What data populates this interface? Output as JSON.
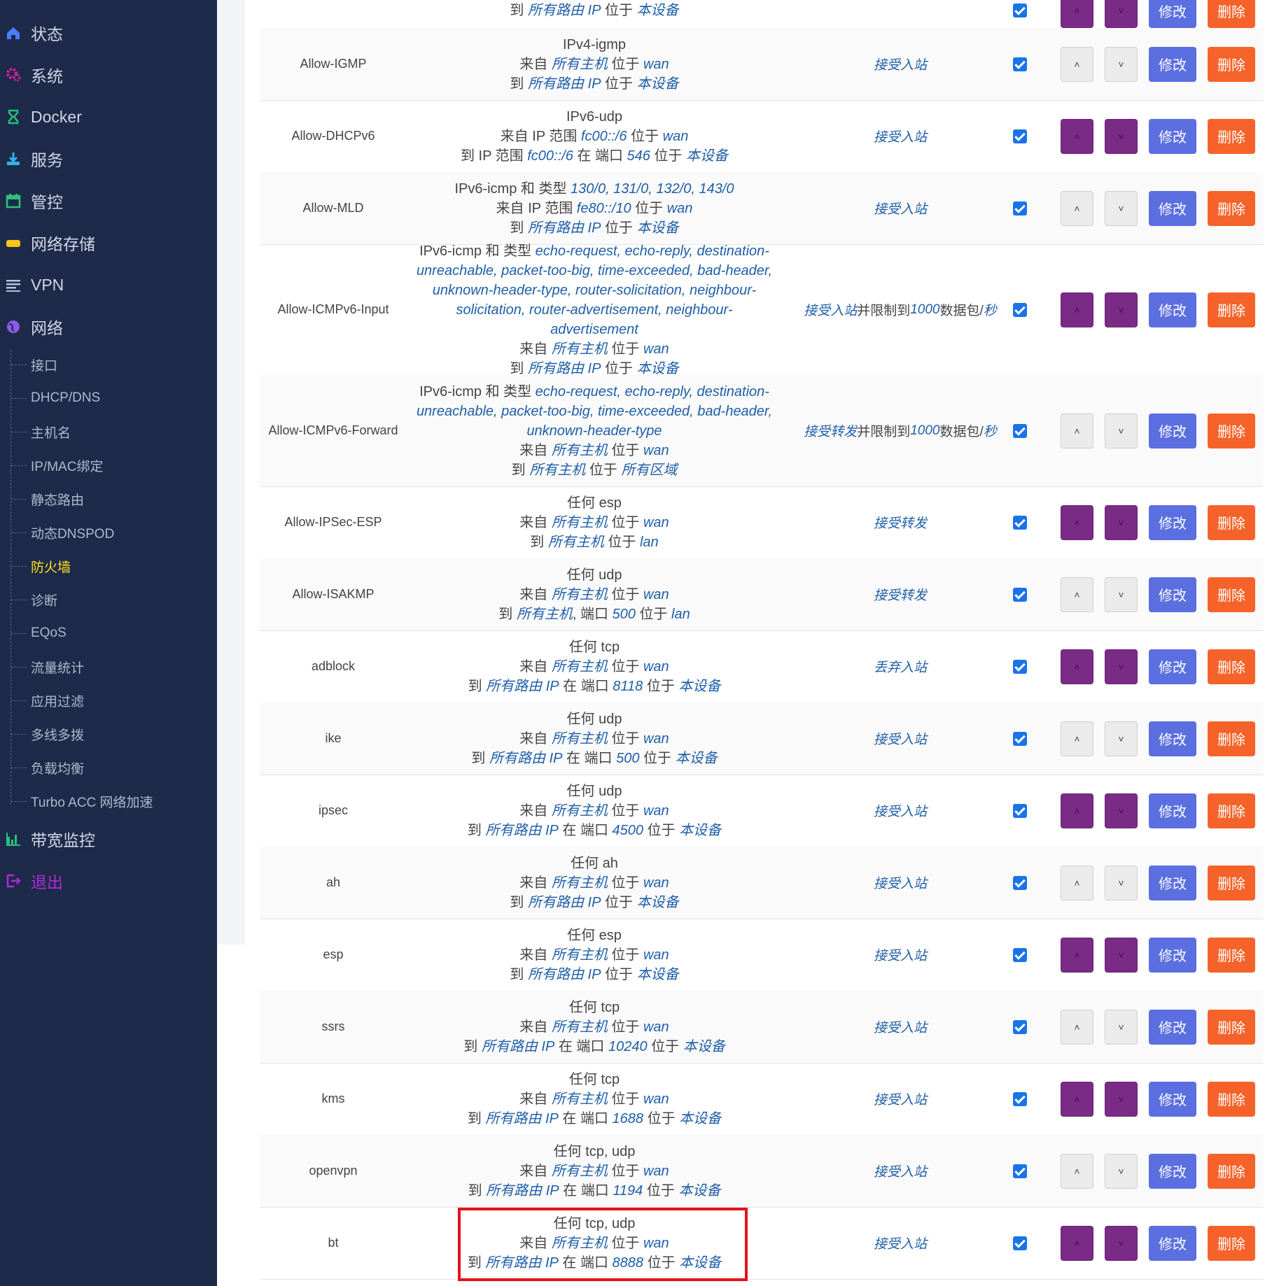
{
  "sidebar": {
    "menu": [
      {
        "label": "状态",
        "icon": "home-icon",
        "color": "#4a7cff"
      },
      {
        "label": "系统",
        "icon": "gears-icon",
        "color": "#e61ca8"
      },
      {
        "label": "Docker",
        "icon": "hourglass-icon",
        "color": "#21c47a"
      },
      {
        "label": "服务",
        "icon": "download-icon",
        "color": "#2fb6e8"
      },
      {
        "label": "管控",
        "icon": "calendar-icon",
        "color": "#2ec07a"
      },
      {
        "label": "网络存储",
        "icon": "drive-icon",
        "color": "#f5c518"
      },
      {
        "label": "VPN",
        "icon": "list-icon",
        "color": "#b8c2d6"
      },
      {
        "label": "网络",
        "icon": "globe-icon",
        "color": "#8a5ce6"
      }
    ],
    "submenu": [
      "接口",
      "DHCP/DNS",
      "主机名",
      "IP/MAC绑定",
      "静态路由",
      "动态DNSPOD",
      "防火墙",
      "诊断",
      "EQoS",
      "流量统计",
      "应用过滤",
      "多线多拨",
      "负载均衡",
      "Turbo ACC 网络加速"
    ],
    "active_sub": "防火墙",
    "menu_bottom": [
      {
        "label": "带宽监控",
        "icon": "bar-chart-icon",
        "color": "#21c47a"
      },
      {
        "label": "退出",
        "icon": "logout-icon",
        "color": "#b02ad6"
      }
    ]
  },
  "buttons": {
    "edit": "修改",
    "delete": "删除",
    "up_glyph": "˄",
    "down_glyph": "˅"
  },
  "rules": [
    {
      "name": "",
      "match": [
        [
          "到 ",
          {
            "h": "所有路由 IP"
          },
          " 位于 ",
          {
            "h": "本设备"
          }
        ]
      ],
      "action": [],
      "style": "purple"
    },
    {
      "name": "Allow-IGMP",
      "match": [
        [
          "IPv4-igmp"
        ],
        [
          "来自 ",
          {
            "h": "所有主机"
          },
          " 位于 ",
          {
            "h": "wan"
          }
        ],
        [
          "到 ",
          {
            "h": "所有路由 IP"
          },
          " 位于 ",
          {
            "h": "本设备"
          }
        ]
      ],
      "action": [
        {
          "h": "接受入站"
        }
      ],
      "style": "light"
    },
    {
      "name": "Allow-DHCPv6",
      "match": [
        [
          "IPv6-udp"
        ],
        [
          "来自 IP 范围 ",
          {
            "h": "fc00::/6"
          },
          " 位于 ",
          {
            "h": "wan"
          }
        ],
        [
          "到 IP 范围 ",
          {
            "h": "fc00::/6"
          },
          " 在 端口 ",
          {
            "h": "546"
          },
          " 位于 ",
          {
            "h": "本设备"
          }
        ]
      ],
      "action": [
        {
          "h": "接受入站"
        }
      ],
      "style": "purple"
    },
    {
      "name": "Allow-MLD",
      "match": [
        [
          "IPv6-icmp 和 类型 ",
          {
            "h": "130/0, 131/0, 132/0, 143/0"
          }
        ],
        [
          "来自 IP 范围 ",
          {
            "h": "fe80::/10"
          },
          " 位于 ",
          {
            "h": "wan"
          }
        ],
        [
          "到 ",
          {
            "h": "所有路由 IP"
          },
          " 位于 ",
          {
            "h": "本设备"
          }
        ]
      ],
      "action": [
        {
          "h": "接受入站"
        }
      ],
      "style": "light"
    },
    {
      "name": "Allow-ICMPv6-Input",
      "match": [
        [
          "IPv6-icmp 和 类型 ",
          {
            "h": "echo-request, echo-reply, destination-unreachable, packet-too-big, time-exceeded, bad-header, unknown-header-type, router-solicitation, neighbour-solicitation, router-advertisement, neighbour-advertisement"
          }
        ],
        [
          "来自 ",
          {
            "h": "所有主机"
          },
          " 位于 ",
          {
            "h": "wan"
          }
        ],
        [
          "到 ",
          {
            "h": "所有路由 IP"
          },
          " 位于 ",
          {
            "h": "本设备"
          }
        ]
      ],
      "action": [
        {
          "h": "接受入站"
        },
        " 并限制到 ",
        {
          "h": "1000"
        },
        " 数据包/",
        {
          "h": "秒"
        }
      ],
      "style": "purple"
    },
    {
      "name": "Allow-ICMPv6-Forward",
      "match": [
        [
          "IPv6-icmp 和 类型 ",
          {
            "h": "echo-request, echo-reply, destination-unreachable, packet-too-big, time-exceeded, bad-header, unknown-header-type"
          }
        ],
        [
          "来自 ",
          {
            "h": "所有主机"
          },
          " 位于 ",
          {
            "h": "wan"
          }
        ],
        [
          "到 ",
          {
            "h": "所有主机"
          },
          " 位于 ",
          {
            "h": "所有区域"
          }
        ]
      ],
      "action": [
        {
          "h": "接受转发"
        },
        " 并限制到 ",
        {
          "h": "1000"
        },
        " 数据包/",
        {
          "h": "秒"
        }
      ],
      "style": "light"
    },
    {
      "name": "Allow-IPSec-ESP",
      "match": [
        [
          "任何 esp"
        ],
        [
          "来自 ",
          {
            "h": "所有主机"
          },
          " 位于 ",
          {
            "h": "wan"
          }
        ],
        [
          "到 ",
          {
            "h": "所有主机"
          },
          " 位于 ",
          {
            "h": "lan"
          }
        ]
      ],
      "action": [
        {
          "h": "接受转发"
        }
      ],
      "style": "purple"
    },
    {
      "name": "Allow-ISAKMP",
      "match": [
        [
          "任何 udp"
        ],
        [
          "来自 ",
          {
            "h": "所有主机"
          },
          " 位于 ",
          {
            "h": "wan"
          }
        ],
        [
          "到 ",
          {
            "h": "所有主机"
          },
          ", 端口 ",
          {
            "h": "500"
          },
          " 位于 ",
          {
            "h": "lan"
          }
        ]
      ],
      "action": [
        {
          "h": "接受转发"
        }
      ],
      "style": "light"
    },
    {
      "name": "adblock",
      "match": [
        [
          "任何 tcp"
        ],
        [
          "来自 ",
          {
            "h": "所有主机"
          },
          " 位于 ",
          {
            "h": "wan"
          }
        ],
        [
          "到 ",
          {
            "h": "所有路由 IP"
          },
          " 在 端口 ",
          {
            "h": "8118"
          },
          " 位于 ",
          {
            "h": "本设备"
          }
        ]
      ],
      "action": [
        {
          "h": "丢弃入站"
        }
      ],
      "style": "purple"
    },
    {
      "name": "ike",
      "match": [
        [
          "任何 udp"
        ],
        [
          "来自 ",
          {
            "h": "所有主机"
          },
          " 位于 ",
          {
            "h": "wan"
          }
        ],
        [
          "到 ",
          {
            "h": "所有路由 IP"
          },
          " 在 端口 ",
          {
            "h": "500"
          },
          " 位于 ",
          {
            "h": "本设备"
          }
        ]
      ],
      "action": [
        {
          "h": "接受入站"
        }
      ],
      "style": "light"
    },
    {
      "name": "ipsec",
      "match": [
        [
          "任何 udp"
        ],
        [
          "来自 ",
          {
            "h": "所有主机"
          },
          " 位于 ",
          {
            "h": "wan"
          }
        ],
        [
          "到 ",
          {
            "h": "所有路由 IP"
          },
          " 在 端口 ",
          {
            "h": "4500"
          },
          " 位于 ",
          {
            "h": "本设备"
          }
        ]
      ],
      "action": [
        {
          "h": "接受入站"
        }
      ],
      "style": "purple"
    },
    {
      "name": "ah",
      "match": [
        [
          "任何 ah"
        ],
        [
          "来自 ",
          {
            "h": "所有主机"
          },
          " 位于 ",
          {
            "h": "wan"
          }
        ],
        [
          "到 ",
          {
            "h": "所有路由 IP"
          },
          " 位于 ",
          {
            "h": "本设备"
          }
        ]
      ],
      "action": [
        {
          "h": "接受入站"
        }
      ],
      "style": "light"
    },
    {
      "name": "esp",
      "match": [
        [
          "任何 esp"
        ],
        [
          "来自 ",
          {
            "h": "所有主机"
          },
          " 位于 ",
          {
            "h": "wan"
          }
        ],
        [
          "到 ",
          {
            "h": "所有路由 IP"
          },
          " 位于 ",
          {
            "h": "本设备"
          }
        ]
      ],
      "action": [
        {
          "h": "接受入站"
        }
      ],
      "style": "purple"
    },
    {
      "name": "ssrs",
      "match": [
        [
          "任何 tcp"
        ],
        [
          "来自 ",
          {
            "h": "所有主机"
          },
          " 位于 ",
          {
            "h": "wan"
          }
        ],
        [
          "到 ",
          {
            "h": "所有路由 IP"
          },
          " 在 端口 ",
          {
            "h": "10240"
          },
          " 位于 ",
          {
            "h": "本设备"
          }
        ]
      ],
      "action": [
        {
          "h": "接受入站"
        }
      ],
      "style": "light"
    },
    {
      "name": "kms",
      "match": [
        [
          "任何 tcp"
        ],
        [
          "来自 ",
          {
            "h": "所有主机"
          },
          " 位于 ",
          {
            "h": "wan"
          }
        ],
        [
          "到 ",
          {
            "h": "所有路由 IP"
          },
          " 在 端口 ",
          {
            "h": "1688"
          },
          " 位于 ",
          {
            "h": "本设备"
          }
        ]
      ],
      "action": [
        {
          "h": "接受入站"
        }
      ],
      "style": "purple"
    },
    {
      "name": "openvpn",
      "match": [
        [
          "任何 tcp, udp"
        ],
        [
          "来自 ",
          {
            "h": "所有主机"
          },
          " 位于 ",
          {
            "h": "wan"
          }
        ],
        [
          "到 ",
          {
            "h": "所有路由 IP"
          },
          " 在 端口 ",
          {
            "h": "1194"
          },
          " 位于 ",
          {
            "h": "本设备"
          }
        ]
      ],
      "action": [
        {
          "h": "接受入站"
        }
      ],
      "style": "light"
    },
    {
      "name": "bt",
      "match": [
        [
          "任何 tcp, udp"
        ],
        [
          "来自 ",
          {
            "h": "所有主机"
          },
          " 位于 ",
          {
            "h": "wan"
          }
        ],
        [
          "到 ",
          {
            "h": "所有路由 IP"
          },
          " 在 端口 ",
          {
            "h": "8888"
          },
          " 位于 ",
          {
            "h": "本设备"
          }
        ]
      ],
      "action": [
        {
          "h": "接受入站"
        }
      ],
      "style": "purple"
    }
  ]
}
